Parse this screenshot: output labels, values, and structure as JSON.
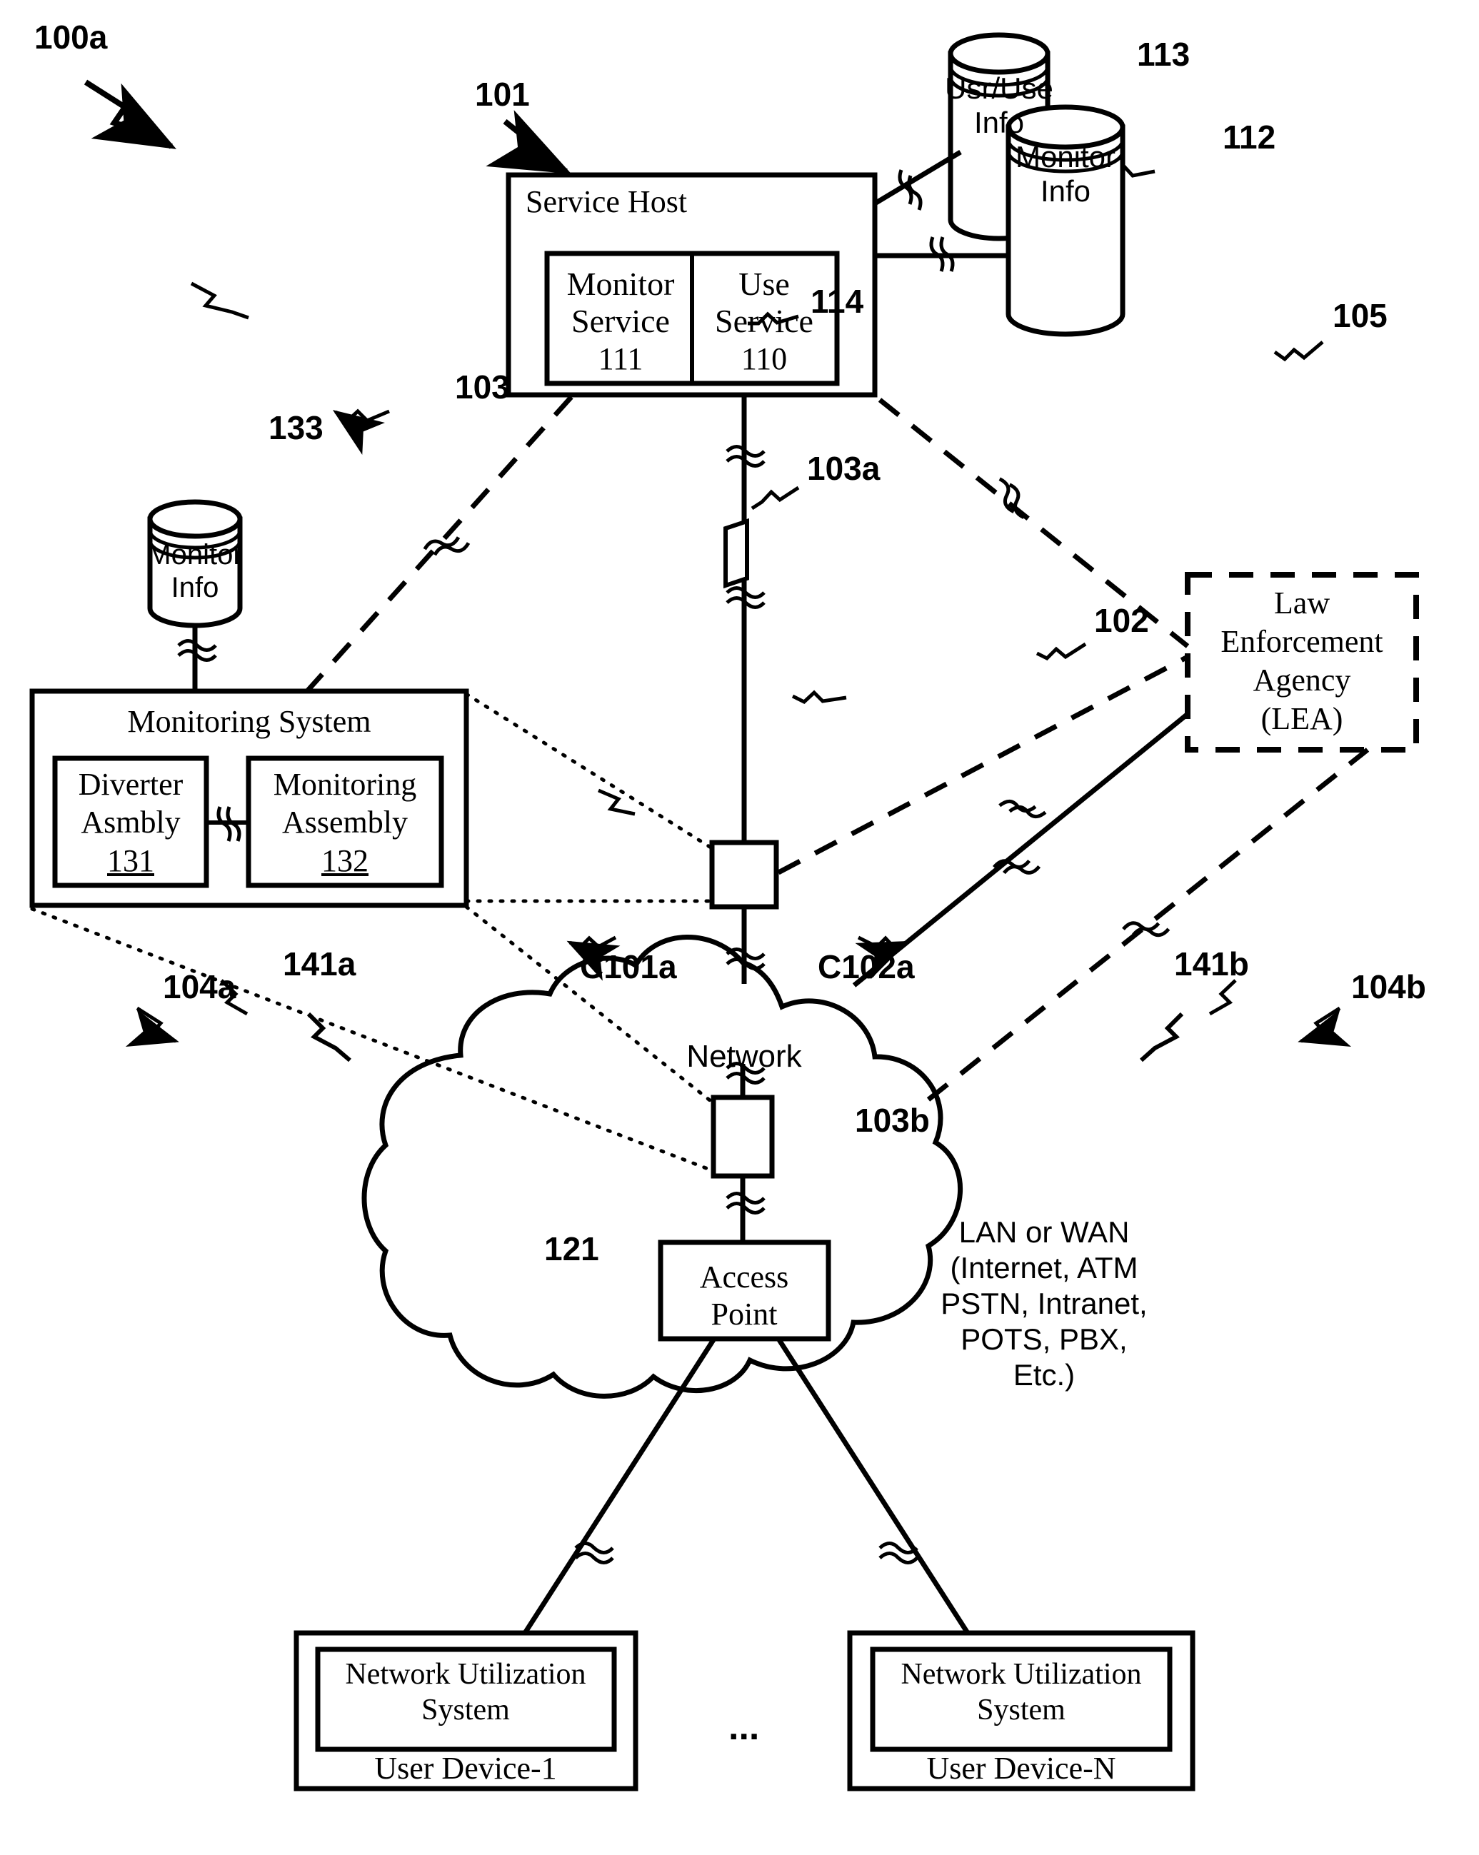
{
  "figure": {
    "id": "100a",
    "type": "patent-network-diagram"
  },
  "nodes": {
    "service_host": {
      "title": "Service Host",
      "ref": "101",
      "children": [
        {
          "name": "Monitor Service",
          "line1": "Monitor",
          "line2": "Service",
          "ref": "111"
        },
        {
          "name": "Use Service",
          "line1": "Use",
          "line2": "Service",
          "ref": "110"
        }
      ]
    },
    "usr_use_info_db": {
      "line1": "Usr/Use",
      "line2": "Info",
      "ref": "113"
    },
    "monitor_info_db_top": {
      "line1": "Monitor",
      "line2": "Info",
      "ref": "112"
    },
    "monitor_info_db_left": {
      "line1": "Monitor",
      "line2": "Info",
      "ref": "133"
    },
    "monitoring_system": {
      "title": "Monitoring System",
      "ref": "103",
      "children": [
        {
          "name": "Diverter Asmbly",
          "line1": "Diverter",
          "line2": "Asmbly",
          "ref": "131"
        },
        {
          "name": "Monitoring Assembly",
          "line1": "Monitoring",
          "line2": "Assembly",
          "ref": "132"
        }
      ]
    },
    "lea": {
      "line1": "Law",
      "line2": "Enforcement",
      "line3": "Agency",
      "line4": "(LEA)",
      "ref": "105"
    },
    "network_cloud": {
      "title": "Network",
      "ref": "102",
      "description_lines": [
        "LAN or WAN",
        "(Internet, ATM",
        "PSTN, Intranet,",
        "POTS, PBX,",
        "Etc.)"
      ]
    },
    "access_point": {
      "line1": "Access",
      "line2": "Point",
      "ref": "121"
    },
    "tap_upper": {
      "ref": "103a"
    },
    "tap_lower": {
      "ref": "103b"
    },
    "link_marker": {
      "ref": "114"
    },
    "user_device_1": {
      "inner_line1": "Network Utilization",
      "inner_line2": "System",
      "inner_ref": "141a",
      "label": "User  Device-1",
      "ref": "104a",
      "connection": "C101a"
    },
    "user_device_n": {
      "inner_line1": "Network Utilization",
      "inner_line2": "System",
      "inner_ref": "141b",
      "label": "User  Device-N",
      "ref": "104b",
      "connection": "C102a"
    },
    "ellipsis": "..."
  },
  "colors": {
    "stroke": "#000000",
    "background": "#ffffff"
  }
}
